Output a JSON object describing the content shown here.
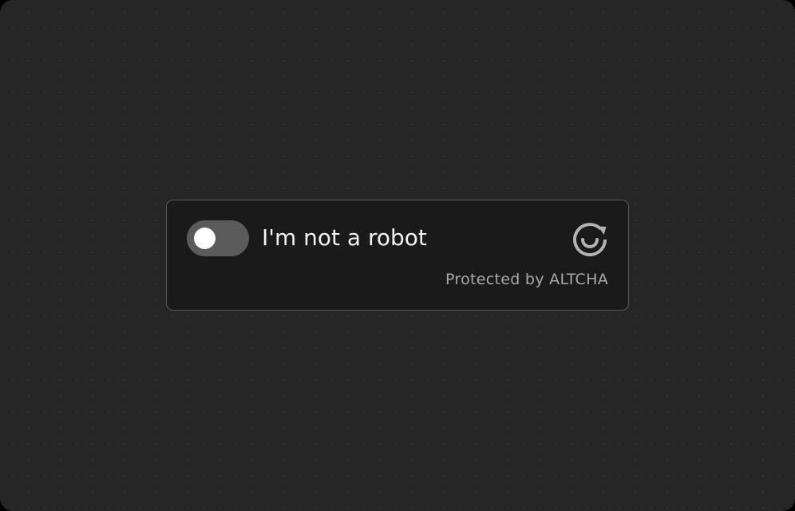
{
  "widget": {
    "checkbox_label": "I'm not a robot",
    "footer_text": "Protected by ALTCHA",
    "toggle_checked": false,
    "logo_icon": "altcha-logo-icon"
  },
  "colors": {
    "background": "#262626",
    "widget_background": "#1a1a1a",
    "widget_border": "#5a5a5a",
    "toggle_track": "#5b5b5b",
    "toggle_knob": "#ffffff",
    "label_text": "#f2f2f2",
    "footer_text": "#a9a9a9"
  }
}
